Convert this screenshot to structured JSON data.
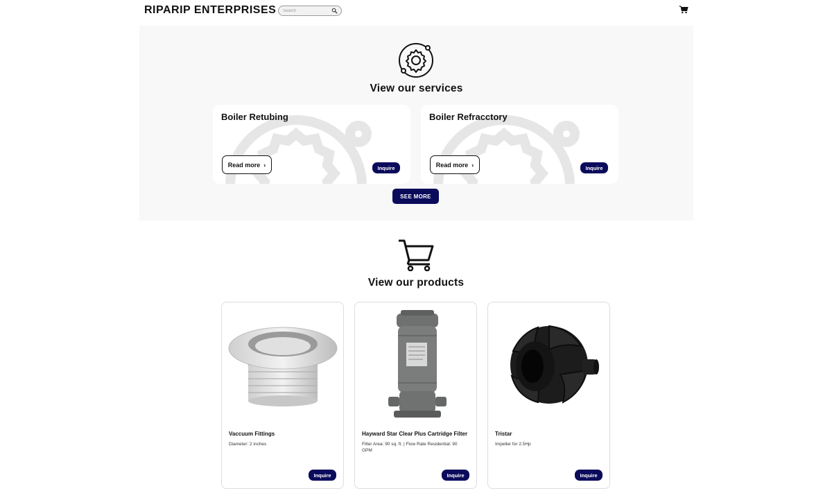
{
  "header": {
    "brand": "RIPARIP ENTERPRISES",
    "search_placeholder": "Search"
  },
  "services": {
    "title": "View our services",
    "cards": [
      {
        "title": "Boiler Retubing",
        "read_more": "Read more",
        "inquire": "Inquire"
      },
      {
        "title": "Boiler Refracctory",
        "read_more": "Read more",
        "inquire": "Inquire"
      }
    ],
    "see_more": "SEE MORE"
  },
  "products": {
    "title": "View our products",
    "items": [
      {
        "name": "Vaccuum Fittings",
        "desc": "Diameter: 2 inches",
        "inquire": "Inquire"
      },
      {
        "name": "Hayward Star Clear Plus Cartridge Filter",
        "desc": "Filter Area: 90 sq. ft. | Flow Rate Residential: 90 GPM",
        "inquire": "Inquire"
      },
      {
        "name": "Tristar",
        "desc": "Impeller for 2.5Hp",
        "inquire": "Inquire"
      }
    ]
  },
  "colors": {
    "accent": "#0b0b5c",
    "section_bg": "#f8f8f8"
  },
  "icons": [
    "search-icon",
    "cart-icon",
    "gear-icon",
    "chevron-right-icon",
    "shopping-cart-icon"
  ]
}
